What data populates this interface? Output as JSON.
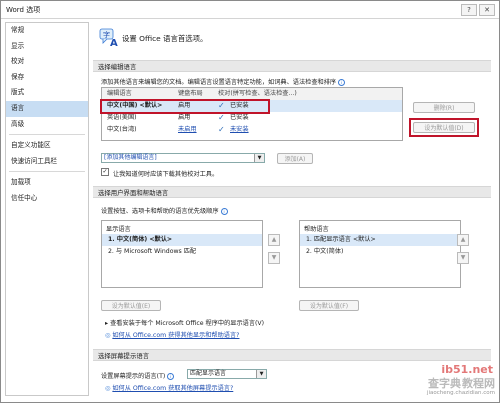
{
  "window": {
    "title": "Word 选项",
    "help_btn": "?",
    "close_btn": "✕"
  },
  "nav": {
    "items": [
      "常规",
      "显示",
      "校对",
      "保存",
      "版式",
      "语言",
      "高级",
      "自定义功能区",
      "快速访问工具栏",
      "加载项",
      "信任中心"
    ],
    "selected": "语言"
  },
  "header": {
    "title": "设置 Office 语言首选项。"
  },
  "editing": {
    "section_title": "选择编辑语言",
    "description": "添加其他语言来编辑您的文档。编辑语言设置语言特定功能，如词典、语法检查和排序",
    "columns": [
      "编辑语言",
      "键盘布局",
      "校对(拼写检查、语法检查...)"
    ],
    "rows": [
      {
        "language": "中文(中国) <默认>",
        "keyboard": "启用",
        "proofing": "已安装"
      },
      {
        "language": "英语(美国)",
        "keyboard": "启用",
        "proofing": "已安装"
      },
      {
        "language": "中文(台湾)",
        "keyboard": "未启用",
        "proofing": "未安装"
      }
    ],
    "delete_btn": "删除(R)",
    "set_default_btn": "设为默认值(D)",
    "add_combo": "[添加其他编辑语言]",
    "add_btn": "添加(A)",
    "checkbox_label": "让我知道何时应该下载其他校对工具。"
  },
  "ui_lang": {
    "section_title": "选择用户界面和帮助语言",
    "description": "设置按钮、选项卡和帮助的语言优先级顺序",
    "display_title": "显示语言",
    "display_items": [
      "1.    中文(简体) <默认>",
      "2.    与 Microsoft Windows 匹配"
    ],
    "help_title": "帮助语言",
    "help_items": [
      "1.    匹配显示语言 <默认>",
      "2.    中文(简体)"
    ],
    "set_default_btn1": "设为默认值(E)",
    "set_default_btn2": "设为默认值(F)",
    "view_installed": "查看安装于每个 Microsoft Office 程序中的显示语言(V)",
    "link": "如何从 Office.com 获得其他显示和帮助语言?"
  },
  "screentip": {
    "section_title": "选择屏幕提示语言",
    "label": "设置屏幕提示的语言(T)",
    "combo_value": "匹配显示语言",
    "link": "如何从 Office.com 获取其他屏幕提示语言?"
  },
  "watermark": {
    "line1": "查字典",
    "line2": "教程网",
    "site": "jiaocheng.chazidian.com",
    "brand": "ib51.net"
  }
}
